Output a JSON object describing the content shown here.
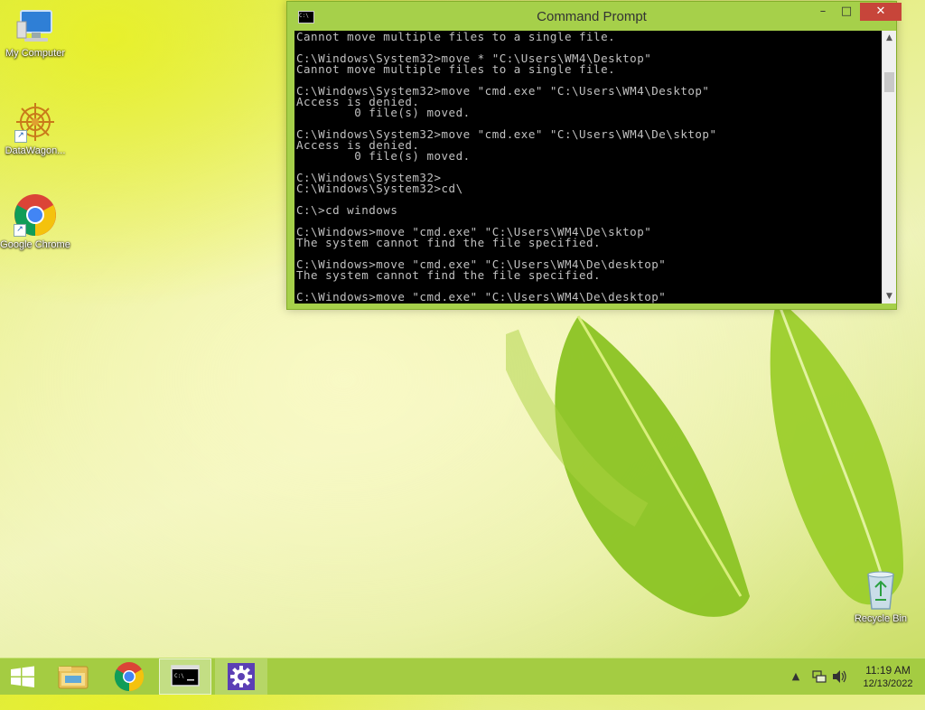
{
  "desktop": {
    "icons": [
      {
        "label": "My Computer",
        "icon": "my-computer-icon"
      },
      {
        "label": "DataWagon...",
        "icon": "datawagon-icon"
      },
      {
        "label": "Google Chrome",
        "icon": "chrome-icon"
      },
      {
        "label": "Recycle Bin",
        "icon": "recycle-bin-icon"
      }
    ]
  },
  "window": {
    "title": "Command Prompt",
    "app_icon_text": "C:\\",
    "controls": {
      "minimize": "–",
      "maximize": "□",
      "close": "✕"
    },
    "console_lines": [
      "Cannot move multiple files to a single file.",
      "",
      "C:\\Windows\\System32>move * \"C:\\Users\\WM4\\Desktop\"",
      "Cannot move multiple files to a single file.",
      "",
      "C:\\Windows\\System32>move \"cmd.exe\" \"C:\\Users\\WM4\\Desktop\"",
      "Access is denied.",
      "        0 file(s) moved.",
      "",
      "C:\\Windows\\System32>move \"cmd.exe\" \"C:\\Users\\WM4\\De\\sktop\"",
      "Access is denied.",
      "        0 file(s) moved.",
      "",
      "C:\\Windows\\System32>",
      "C:\\Windows\\System32>cd\\",
      "",
      "C:\\>cd windows",
      "",
      "C:\\Windows>move \"cmd.exe\" \"C:\\Users\\WM4\\De\\sktop\"",
      "The system cannot find the file specified.",
      "",
      "C:\\Windows>move \"cmd.exe\" \"C:\\Users\\WM4\\De\\desktop\"",
      "The system cannot find the file specified.",
      "",
      "C:\\Windows>move \"cmd.exe\" \"C:\\Users\\WM4\\De\\desktop\""
    ],
    "colors": {
      "frame": "#a6d04a",
      "console_bg": "#000000",
      "console_text": "#c0c0c0",
      "close": "#c7453a"
    }
  },
  "taskbar": {
    "items": [
      {
        "name": "start",
        "icon": "windows-logo-icon"
      },
      {
        "name": "file-explorer",
        "icon": "folder-icon"
      },
      {
        "name": "google-chrome",
        "icon": "chrome-icon"
      },
      {
        "name": "command-prompt",
        "icon": "cmd-icon",
        "active": true
      },
      {
        "name": "settings",
        "icon": "gear-icon"
      }
    ],
    "tray": {
      "chevron": "▲",
      "network": "network-icon",
      "volume": "volume-icon"
    },
    "clock": {
      "time": "11:19 AM",
      "date": "12/13/2022"
    },
    "colors": {
      "bar": "#a4cc42"
    }
  }
}
